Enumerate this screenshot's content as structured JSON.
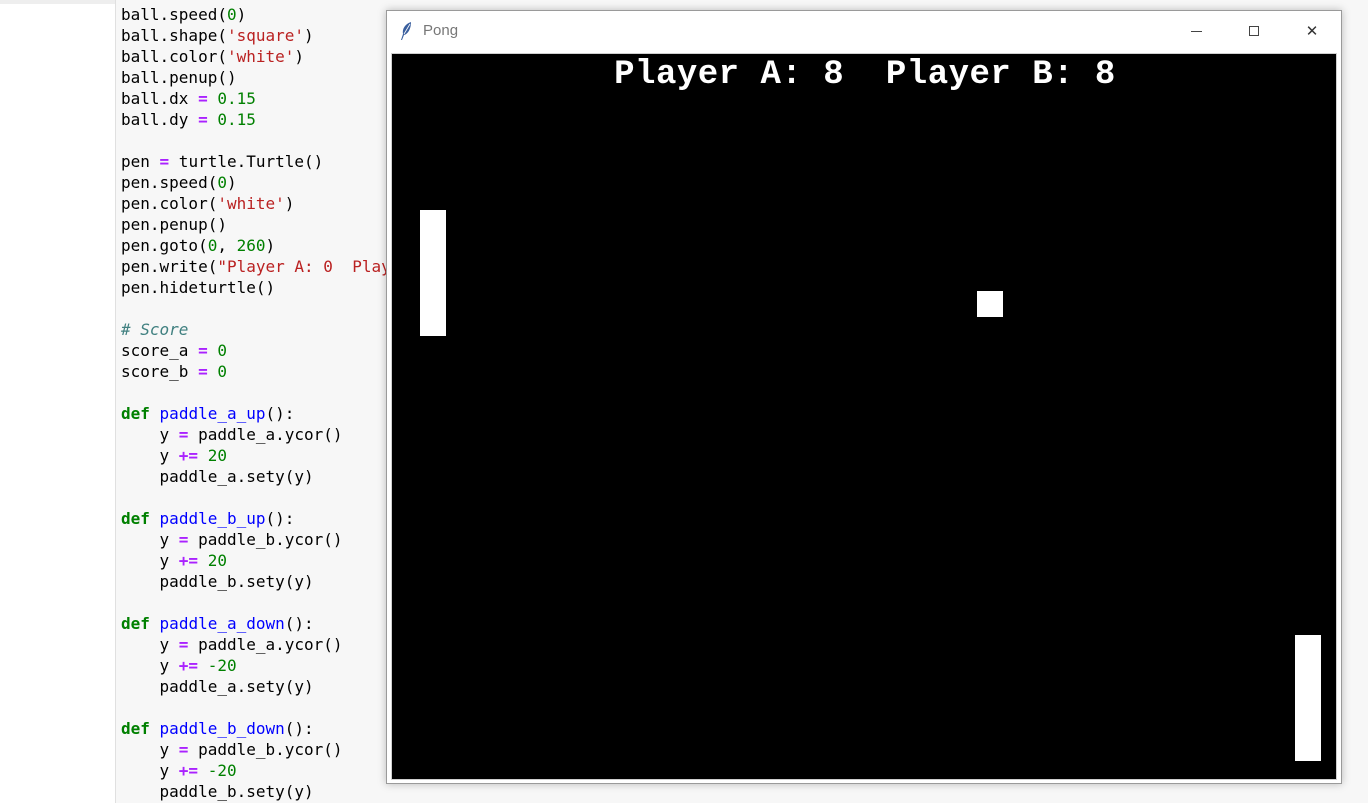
{
  "editor": {
    "lines": [
      [
        [
          "",
          "ball.speed("
        ],
        [
          "num",
          "0"
        ],
        [
          "",
          ")"
        ]
      ],
      [
        [
          "",
          "ball.shape("
        ],
        [
          "str",
          "'square'"
        ],
        [
          "",
          ")"
        ]
      ],
      [
        [
          "",
          "ball.color("
        ],
        [
          "str",
          "'white'"
        ],
        [
          "",
          ")"
        ]
      ],
      [
        [
          "",
          "ball.penup()"
        ]
      ],
      [
        [
          "",
          "ball.dx "
        ],
        [
          "op",
          "="
        ],
        [
          "",
          ""
        ],
        [
          "num",
          " 0.15"
        ]
      ],
      [
        [
          "",
          "ball.dy "
        ],
        [
          "op",
          "="
        ],
        [
          "num",
          " 0.15"
        ]
      ],
      [
        [
          "",
          ""
        ]
      ],
      [
        [
          "",
          "pen "
        ],
        [
          "op",
          "="
        ],
        [
          "",
          " turtle.Turtle()"
        ]
      ],
      [
        [
          "",
          "pen.speed("
        ],
        [
          "num",
          "0"
        ],
        [
          "",
          ")"
        ]
      ],
      [
        [
          "",
          "pen.color("
        ],
        [
          "str",
          "'white'"
        ],
        [
          "",
          ")"
        ]
      ],
      [
        [
          "",
          "pen.penup()"
        ]
      ],
      [
        [
          "",
          "pen.goto("
        ],
        [
          "num",
          "0"
        ],
        [
          "",
          ", "
        ],
        [
          "num",
          "260"
        ],
        [
          "",
          ")"
        ]
      ],
      [
        [
          "",
          "pen.write("
        ],
        [
          "str",
          "\"Player A: 0  Play"
        ]
      ],
      [
        [
          "",
          "pen.hideturtle()"
        ]
      ],
      [
        [
          "",
          ""
        ]
      ],
      [
        [
          "cm",
          "# Score"
        ]
      ],
      [
        [
          "",
          "score_a "
        ],
        [
          "op",
          "="
        ],
        [
          "num",
          " 0"
        ]
      ],
      [
        [
          "",
          "score_b "
        ],
        [
          "op",
          "="
        ],
        [
          "num",
          " 0"
        ]
      ],
      [
        [
          "",
          ""
        ]
      ],
      [
        [
          "kw",
          "def"
        ],
        [
          "",
          " "
        ],
        [
          "fn",
          "paddle_a_up"
        ],
        [
          "",
          "():"
        ]
      ],
      [
        [
          "",
          "    y "
        ],
        [
          "op",
          "="
        ],
        [
          "",
          " paddle_a.ycor()"
        ]
      ],
      [
        [
          "",
          "    y "
        ],
        [
          "op",
          "+="
        ],
        [
          "num",
          " 20"
        ]
      ],
      [
        [
          "",
          "    paddle_a.sety(y)"
        ]
      ],
      [
        [
          "",
          ""
        ]
      ],
      [
        [
          "kw",
          "def"
        ],
        [
          "",
          " "
        ],
        [
          "fn",
          "paddle_b_up"
        ],
        [
          "",
          "():"
        ]
      ],
      [
        [
          "",
          "    y "
        ],
        [
          "op",
          "="
        ],
        [
          "",
          " paddle_b.ycor()"
        ]
      ],
      [
        [
          "",
          "    y "
        ],
        [
          "op",
          "+="
        ],
        [
          "num",
          " 20"
        ]
      ],
      [
        [
          "",
          "    paddle_b.sety(y)"
        ]
      ],
      [
        [
          "",
          ""
        ]
      ],
      [
        [
          "kw",
          "def"
        ],
        [
          "",
          " "
        ],
        [
          "fn",
          "paddle_a_down"
        ],
        [
          "",
          "():"
        ]
      ],
      [
        [
          "",
          "    y "
        ],
        [
          "op",
          "="
        ],
        [
          "",
          " paddle_a.ycor()"
        ]
      ],
      [
        [
          "",
          "    y "
        ],
        [
          "op",
          "+="
        ],
        [
          "num",
          " -20"
        ]
      ],
      [
        [
          "",
          "    paddle_a.sety(y)"
        ]
      ],
      [
        [
          "",
          ""
        ]
      ],
      [
        [
          "kw",
          "def"
        ],
        [
          "",
          " "
        ],
        [
          "fn",
          "paddle_b_down"
        ],
        [
          "",
          "():"
        ]
      ],
      [
        [
          "",
          "    y "
        ],
        [
          "op",
          "="
        ],
        [
          "",
          " paddle_b.ycor()"
        ]
      ],
      [
        [
          "",
          "    y "
        ],
        [
          "op",
          "+="
        ],
        [
          "num",
          " -20"
        ]
      ],
      [
        [
          "",
          "    paddle_b.sety(y)"
        ]
      ]
    ]
  },
  "window": {
    "title": "Pong",
    "icon": "feather-icon",
    "controls": {
      "minimize": "minimize-icon",
      "maximize": "maximize-icon",
      "close_glyph": "✕"
    }
  },
  "game": {
    "score_text": "Player A: 8  Player B: 8",
    "colors": {
      "background": "#000000",
      "foreground": "#ffffff"
    }
  }
}
